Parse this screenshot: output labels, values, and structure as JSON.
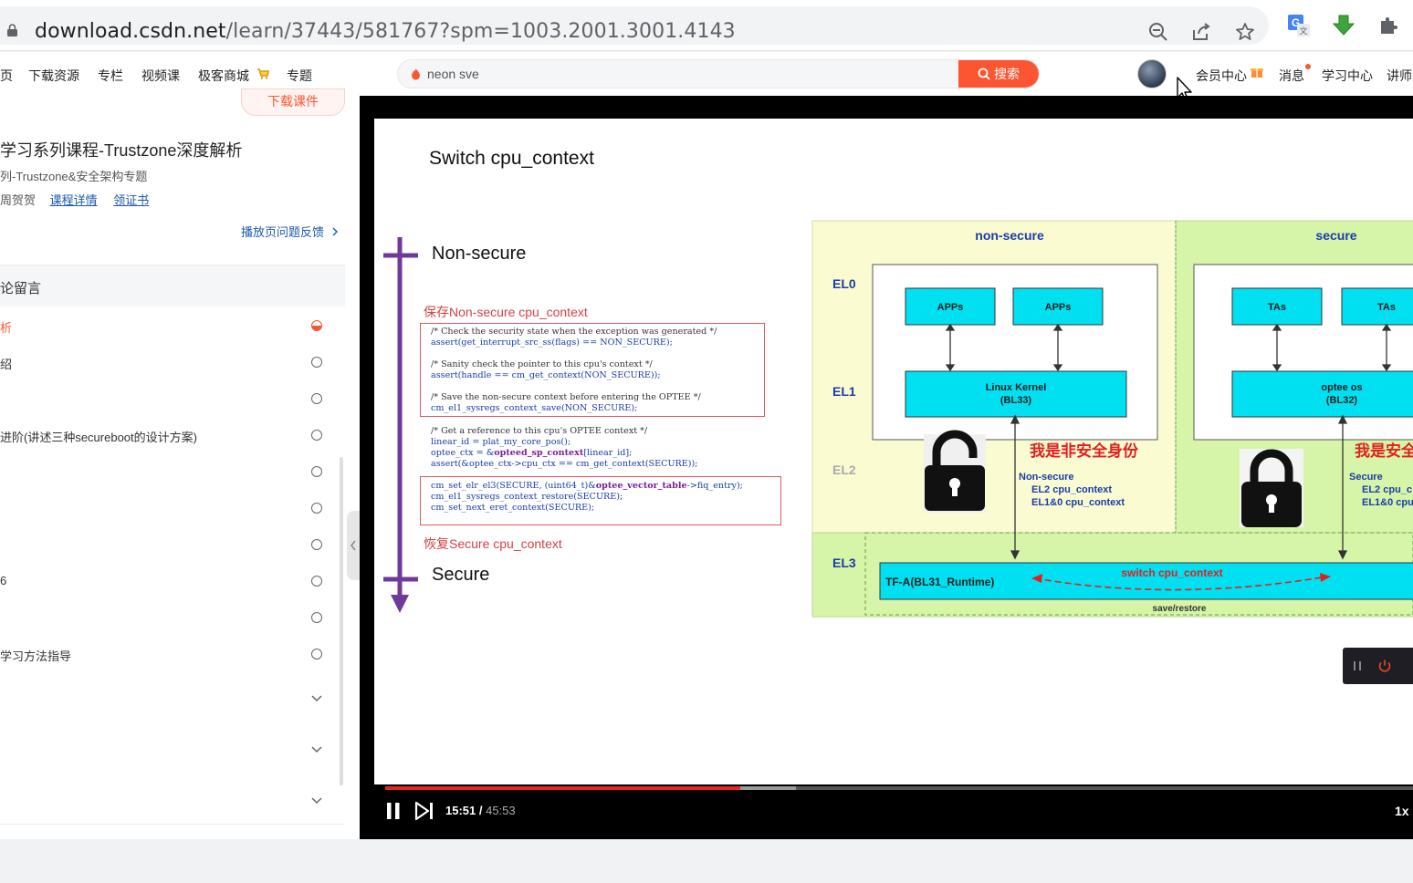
{
  "browser": {
    "url_host": "download.csdn.net",
    "url_path": "/learn/37443/581767?spm=1003.2001.3001.4143"
  },
  "nav": {
    "items": [
      "页",
      "下载资源",
      "专栏",
      "视频课",
      "极客商城",
      "专题"
    ],
    "search_value": "neon sve",
    "search_button": "搜索",
    "right_items": [
      "会员中心",
      "消息",
      "学习中心",
      "讲师"
    ]
  },
  "course": {
    "download_chip": "下载课件",
    "title": "学习系列课程-Trustzone深度解析",
    "subtitle": "列-Trustzone&安全架构专题",
    "author_fragment": "周贺贺",
    "link_detail": "课程详情",
    "link_cert": "领证书",
    "feedback": "播放页问题反馈",
    "tab_label": "论留言",
    "chapters": [
      {
        "label": "析",
        "state": "playing"
      },
      {
        "label": "绍",
        "state": "unread"
      },
      {
        "label": "",
        "state": "unread"
      },
      {
        "label": "进阶(讲述三种secureboot的设计方案)",
        "state": "unread"
      },
      {
        "label": "",
        "state": "unread"
      },
      {
        "label": "",
        "state": "unread"
      },
      {
        "label": "",
        "state": "unread"
      },
      {
        "label": "6",
        "state": "unread"
      },
      {
        "label": "",
        "state": "unread"
      },
      {
        "label": "学习方法指导",
        "state": "unread"
      },
      {
        "label": "",
        "state": "collapsed"
      },
      {
        "label": "",
        "state": "collapsed"
      },
      {
        "label": "",
        "state": "collapsed"
      }
    ]
  },
  "slide": {
    "title": "Switch cpu_context",
    "timeline_top": "Non-secure",
    "timeline_bottom": "Secure",
    "save_caption": "保存Non-secure cpu_context",
    "restore_caption": "恢复Secure cpu_context",
    "diagram": {
      "col_nonsecure": "non-secure",
      "col_secure": "secure",
      "el0": "EL0",
      "el1": "EL1",
      "el2": "EL2",
      "el3": "EL3",
      "apps1": "APPs",
      "apps2": "APPs",
      "tas1": "TAs",
      "tas2": "TAs",
      "linux_kernel": "Linux Kernel",
      "linux_bl": "(BL33)",
      "optee": "optee os",
      "optee_bl": "(BL32)",
      "ns_identity": "我是非安全身份",
      "s_identity": "我是安全",
      "ns_ctx_title": "Non-secure",
      "ns_ctx_el2": "EL2 cpu_context",
      "ns_ctx_el1": "EL1&0 cpu_context",
      "s_ctx_title": "Secure",
      "s_ctx_el2": "EL2 cpu_c",
      "s_ctx_el1": "EL1&0 cpu",
      "tfa": "TF-A(BL31_Runtime)",
      "switch_label": "switch cpu_context",
      "save_restore": "save/restore"
    }
  },
  "player": {
    "current_time": "15:51",
    "duration": "45:53",
    "played_fraction": 0.3455,
    "buffered_fraction": 0.4
  }
}
